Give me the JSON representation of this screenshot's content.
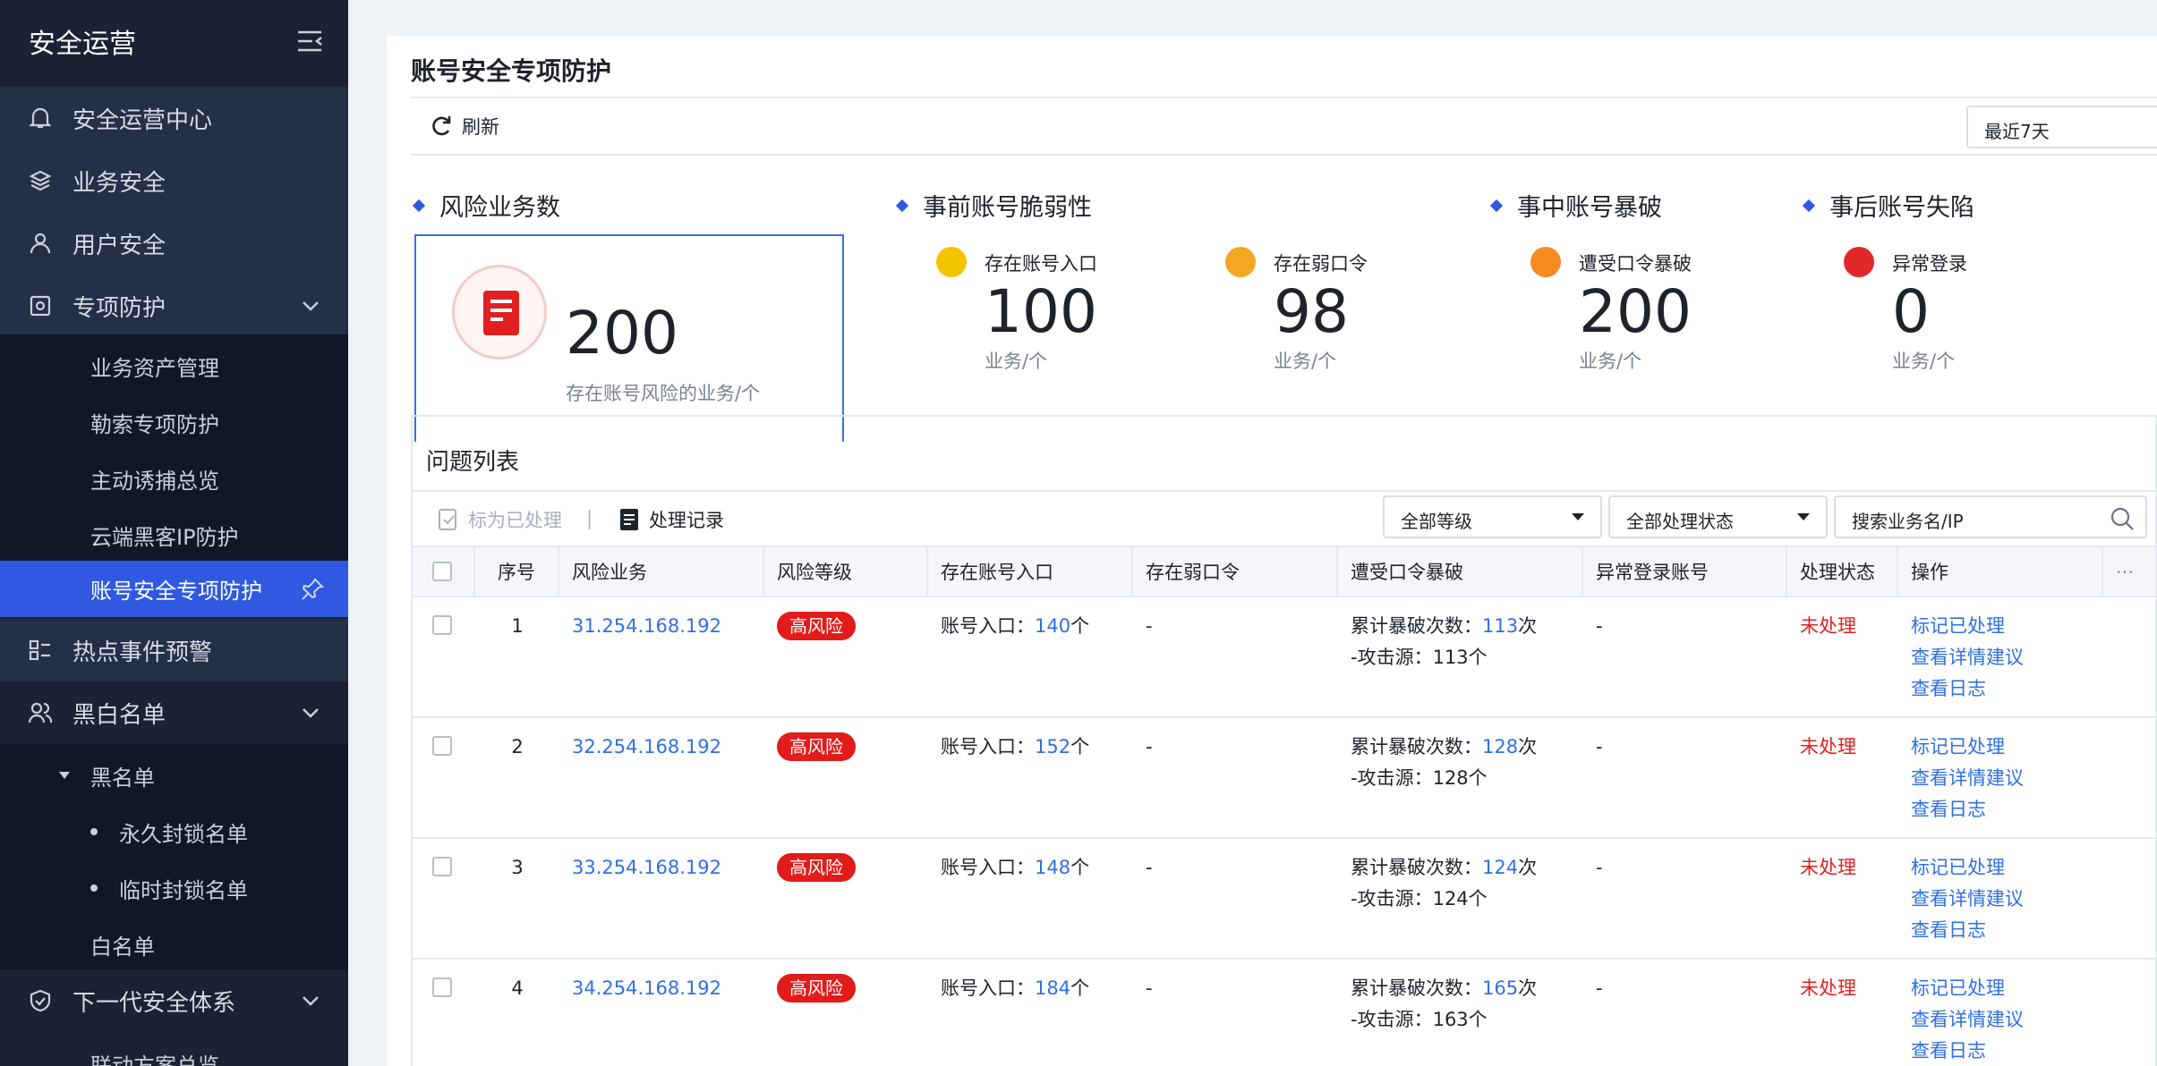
{
  "sidebar": {
    "title": "安全运营",
    "items": [
      {
        "label": "安全运营中心"
      },
      {
        "label": "业务安全"
      },
      {
        "label": "用户安全"
      },
      {
        "label": "专项防护"
      },
      {
        "label": "业务资产管理"
      },
      {
        "label": "勒索专项防护"
      },
      {
        "label": "主动诱捕总览"
      },
      {
        "label": "云端黑客IP防护"
      },
      {
        "label": "账号安全专项防护"
      },
      {
        "label": "热点事件预警"
      },
      {
        "label": "黑白名单"
      },
      {
        "label": "黑名单"
      },
      {
        "label": "永久封锁名单"
      },
      {
        "label": "临时封锁名单"
      },
      {
        "label": "白名单"
      },
      {
        "label": "下一代安全体系"
      },
      {
        "label": "联动方案总览"
      }
    ]
  },
  "page": {
    "title": "账号安全专项防护",
    "refresh_label": "刷新",
    "range": "最近7天"
  },
  "sections": {
    "risk": {
      "title": "风险业务数",
      "value": "200",
      "desc": "存在账号风险的业务/个"
    },
    "pre": {
      "title": "事前账号脆弱性"
    },
    "mid": {
      "title": "事中账号暴破"
    },
    "post": {
      "title": "事后账号失陷"
    }
  },
  "metrics": [
    {
      "label": "存在账号入口",
      "value": "100",
      "unit": "业务/个",
      "color": "#f5b800"
    },
    {
      "label": "存在弱口令",
      "value": "98",
      "unit": "业务/个",
      "color": "#f5a623"
    },
    {
      "label": "遭受口令暴破",
      "value": "200",
      "unit": "业务/个",
      "color": "#f58a23"
    },
    {
      "label": "异常登录",
      "value": "0",
      "unit": "业务/个",
      "color": "#e02828"
    }
  ],
  "issues": {
    "title": "问题列表",
    "mark_label": "标为已处理",
    "separator": "|",
    "log_label": "处理记录",
    "level_select": "全部等级",
    "status_select": "全部处理状态",
    "search_placeholder": "搜索业务名/IP",
    "columns": [
      "序号",
      "风险业务",
      "风险等级",
      "存在账号入口",
      "存在弱口令",
      "遭受口令暴破",
      "异常登录账号",
      "处理状态",
      "操作"
    ],
    "more": "···",
    "rows": [
      {
        "no": "1",
        "ip": "31.254.168.192",
        "level": "高风险",
        "entry_prefix": "账号入口：",
        "entry_count": "140",
        "entry_unit": "个",
        "weak": "-",
        "brute_prefix": "累计暴破次数：",
        "brute_count": "113",
        "brute_unit": "次",
        "source": "-攻击源：113个",
        "abnormal": "-",
        "status": "未处理"
      },
      {
        "no": "2",
        "ip": "32.254.168.192",
        "level": "高风险",
        "entry_prefix": "账号入口：",
        "entry_count": "152",
        "entry_unit": "个",
        "weak": "-",
        "brute_prefix": "累计暴破次数：",
        "brute_count": "128",
        "brute_unit": "次",
        "source": "-攻击源：128个",
        "abnormal": "-",
        "status": "未处理"
      },
      {
        "no": "3",
        "ip": "33.254.168.192",
        "level": "高风险",
        "entry_prefix": "账号入口：",
        "entry_count": "148",
        "entry_unit": "个",
        "weak": "-",
        "brute_prefix": "累计暴破次数：",
        "brute_count": "124",
        "brute_unit": "次",
        "source": "-攻击源：124个",
        "abnormal": "-",
        "status": "未处理"
      },
      {
        "no": "4",
        "ip": "34.254.168.192",
        "level": "高风险",
        "entry_prefix": "账号入口：",
        "entry_count": "184",
        "entry_unit": "个",
        "weak": "-",
        "brute_prefix": "累计暴破次数：",
        "brute_count": "165",
        "brute_unit": "次",
        "source": "-攻击源：163个",
        "abnormal": "-",
        "status": "未处理"
      }
    ],
    "ops": [
      "标记已处理",
      "查看详情建议",
      "查看日志"
    ]
  }
}
